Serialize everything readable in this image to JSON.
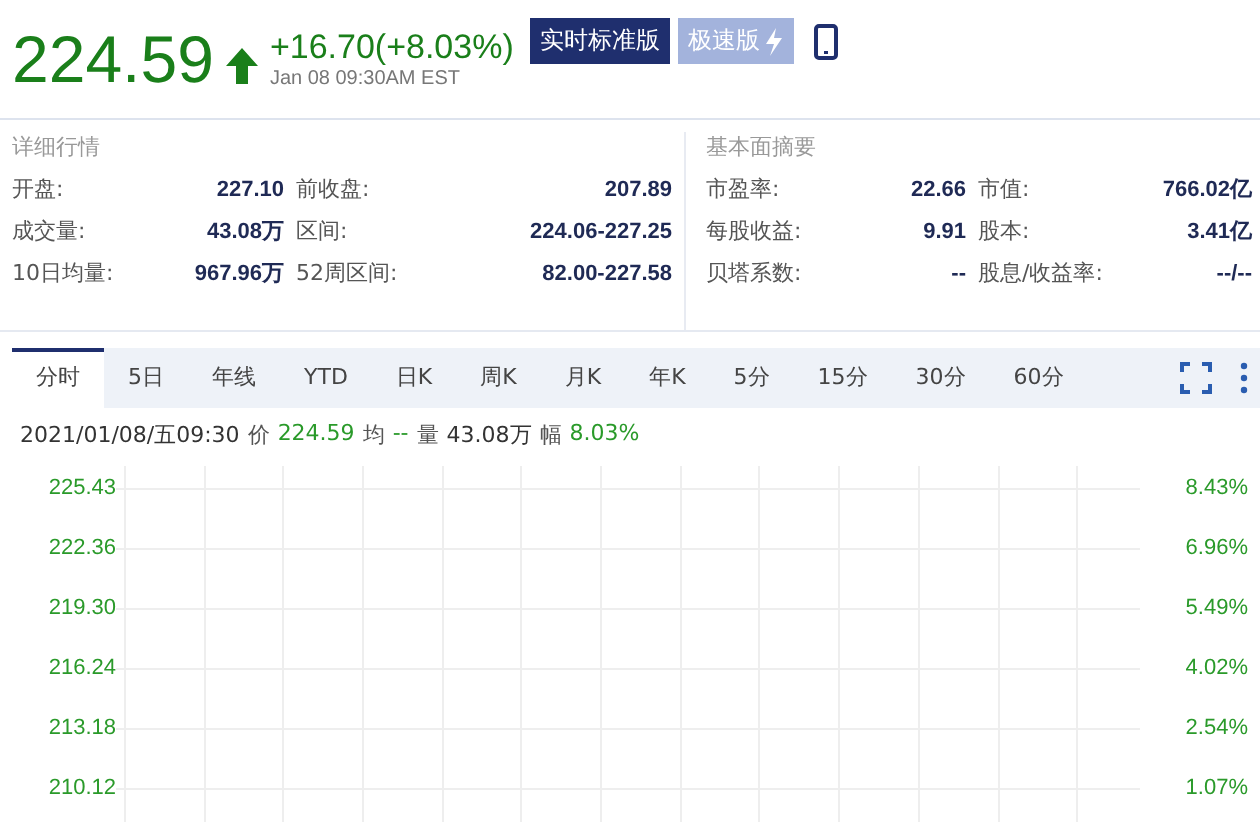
{
  "quote": {
    "price": "224.59",
    "rising": true,
    "change": "+16.70(+8.03%)",
    "time": "Jan 08 09:30AM EST"
  },
  "versions": [
    {
      "label": "实时标准版",
      "selected": true,
      "kind": "plain"
    },
    {
      "label": "极速版",
      "selected": false,
      "kind": "bolt"
    }
  ],
  "details": {
    "title": "详细行情",
    "rows": [
      [
        {
          "label": "开盘:",
          "value": "227.10"
        },
        {
          "label": "前收盘:",
          "value": "207.89"
        }
      ],
      [
        {
          "label": "成交量:",
          "value": "43.08万"
        },
        {
          "label": "区间:",
          "value": "224.06-227.25"
        }
      ],
      [
        {
          "label": "10日均量:",
          "value": "967.96万"
        },
        {
          "label": "52周区间:",
          "value": "82.00-227.58"
        }
      ]
    ]
  },
  "fundamentals": {
    "title": "基本面摘要",
    "rows": [
      [
        {
          "label": "市盈率:",
          "value": "22.66"
        },
        {
          "label": "市值:",
          "value": "766.02亿"
        }
      ],
      [
        {
          "label": "每股收益:",
          "value": "9.91"
        },
        {
          "label": "股本:",
          "value": "3.41亿"
        }
      ],
      [
        {
          "label": "贝塔系数:",
          "value": "--"
        },
        {
          "label": "股息/收益率:",
          "value": "--/--"
        }
      ]
    ]
  },
  "tabs": [
    {
      "label": "分时",
      "selected": true
    },
    {
      "label": "5日",
      "selected": false
    },
    {
      "label": "年线",
      "selected": false
    },
    {
      "label": "YTD",
      "selected": false
    },
    {
      "label": "日K",
      "selected": false
    },
    {
      "label": "周K",
      "selected": false
    },
    {
      "label": "月K",
      "selected": false
    },
    {
      "label": "年K",
      "selected": false
    },
    {
      "label": "5分",
      "selected": false
    },
    {
      "label": "15分",
      "selected": false
    },
    {
      "label": "30分",
      "selected": false
    },
    {
      "label": "60分",
      "selected": false
    }
  ],
  "info_line": {
    "datetime": "2021/01/08/五09:30",
    "price_label": "价",
    "price": "224.59",
    "avg_label": "均",
    "avg": "--",
    "volume_label": "量",
    "volume": "43.08万",
    "range_label": "幅",
    "range": "8.03%"
  },
  "chart": {
    "price_labels": [
      "225.43",
      "222.36",
      "219.30",
      "216.24",
      "213.18",
      "210.12"
    ],
    "percent_labels": [
      "8.43%",
      "6.96%",
      "5.49%",
      "4.02%",
      "2.54%",
      "1.07%"
    ]
  }
}
